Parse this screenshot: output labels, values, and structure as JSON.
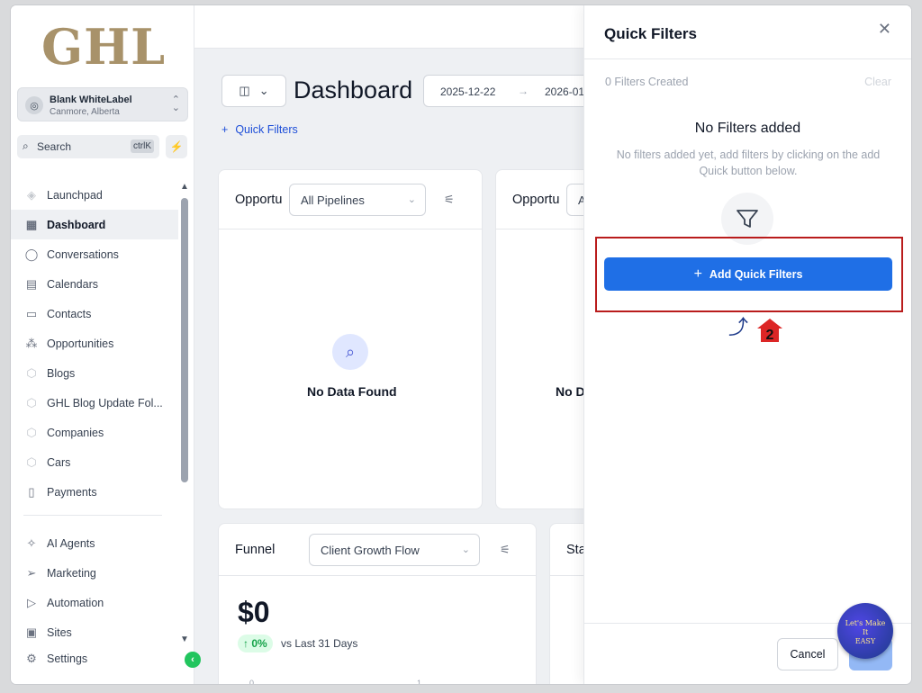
{
  "sidebar": {
    "logo": "GHL",
    "account": {
      "name": "Blank WhiteLabel",
      "location": "Canmore, Alberta"
    },
    "search": {
      "label": "Search",
      "shortcut": "ctrlK"
    },
    "items": [
      {
        "label": "Launchpad",
        "icon": "rocket-icon"
      },
      {
        "label": "Dashboard",
        "icon": "grid-icon"
      },
      {
        "label": "Conversations",
        "icon": "chat-icon"
      },
      {
        "label": "Calendars",
        "icon": "calendar-icon"
      },
      {
        "label": "Contacts",
        "icon": "contacts-icon"
      },
      {
        "label": "Opportunities",
        "icon": "nodes-icon"
      },
      {
        "label": "Blogs",
        "icon": "cube-icon"
      },
      {
        "label": "GHL Blog Update Fol...",
        "icon": "cube-icon"
      },
      {
        "label": "Companies",
        "icon": "cube-icon"
      },
      {
        "label": "Cars",
        "icon": "cube-icon"
      },
      {
        "label": "Payments",
        "icon": "payments-icon"
      }
    ],
    "items2": [
      {
        "label": "AI Agents",
        "icon": "sparkle-icon"
      },
      {
        "label": "Marketing",
        "icon": "send-icon"
      },
      {
        "label": "Automation",
        "icon": "play-icon"
      },
      {
        "label": "Sites",
        "icon": "sites-icon"
      },
      {
        "label": "Settings",
        "icon": "gear-icon"
      }
    ]
  },
  "main": {
    "title": "Dashboard",
    "date_start": "2025-12-22",
    "date_end": "2026-01",
    "quick_filters_link": "Quick Filters",
    "card1": {
      "title": "Opportu",
      "dropdown": "All Pipelines",
      "empty": "No Data Found"
    },
    "card2": {
      "title": "Opportu",
      "dropdown": "A",
      "empty": "No D"
    },
    "card3": {
      "title": "Funnel",
      "dropdown": "Client Growth Flow",
      "amount": "$0",
      "change": "↑ 0%",
      "vs": "vs Last 31 Days",
      "tick0": "0",
      "tick1": "1"
    },
    "card4": {
      "title": "Sta"
    }
  },
  "panel": {
    "title": "Quick Filters",
    "count": "0 Filters Created",
    "clear": "Clear",
    "empty_title": "No Filters added",
    "empty_desc": "No filters added yet, add filters by clicking on the add Quick button below.",
    "add_button": "Add Quick Filters",
    "cancel": "Cancel",
    "step": "2"
  },
  "stamp": {
    "text": "Let's Make It EASY"
  },
  "colors": {
    "accent": "#1f6fe6",
    "highlight": "#b91c1c",
    "logo": "#a8926a"
  }
}
